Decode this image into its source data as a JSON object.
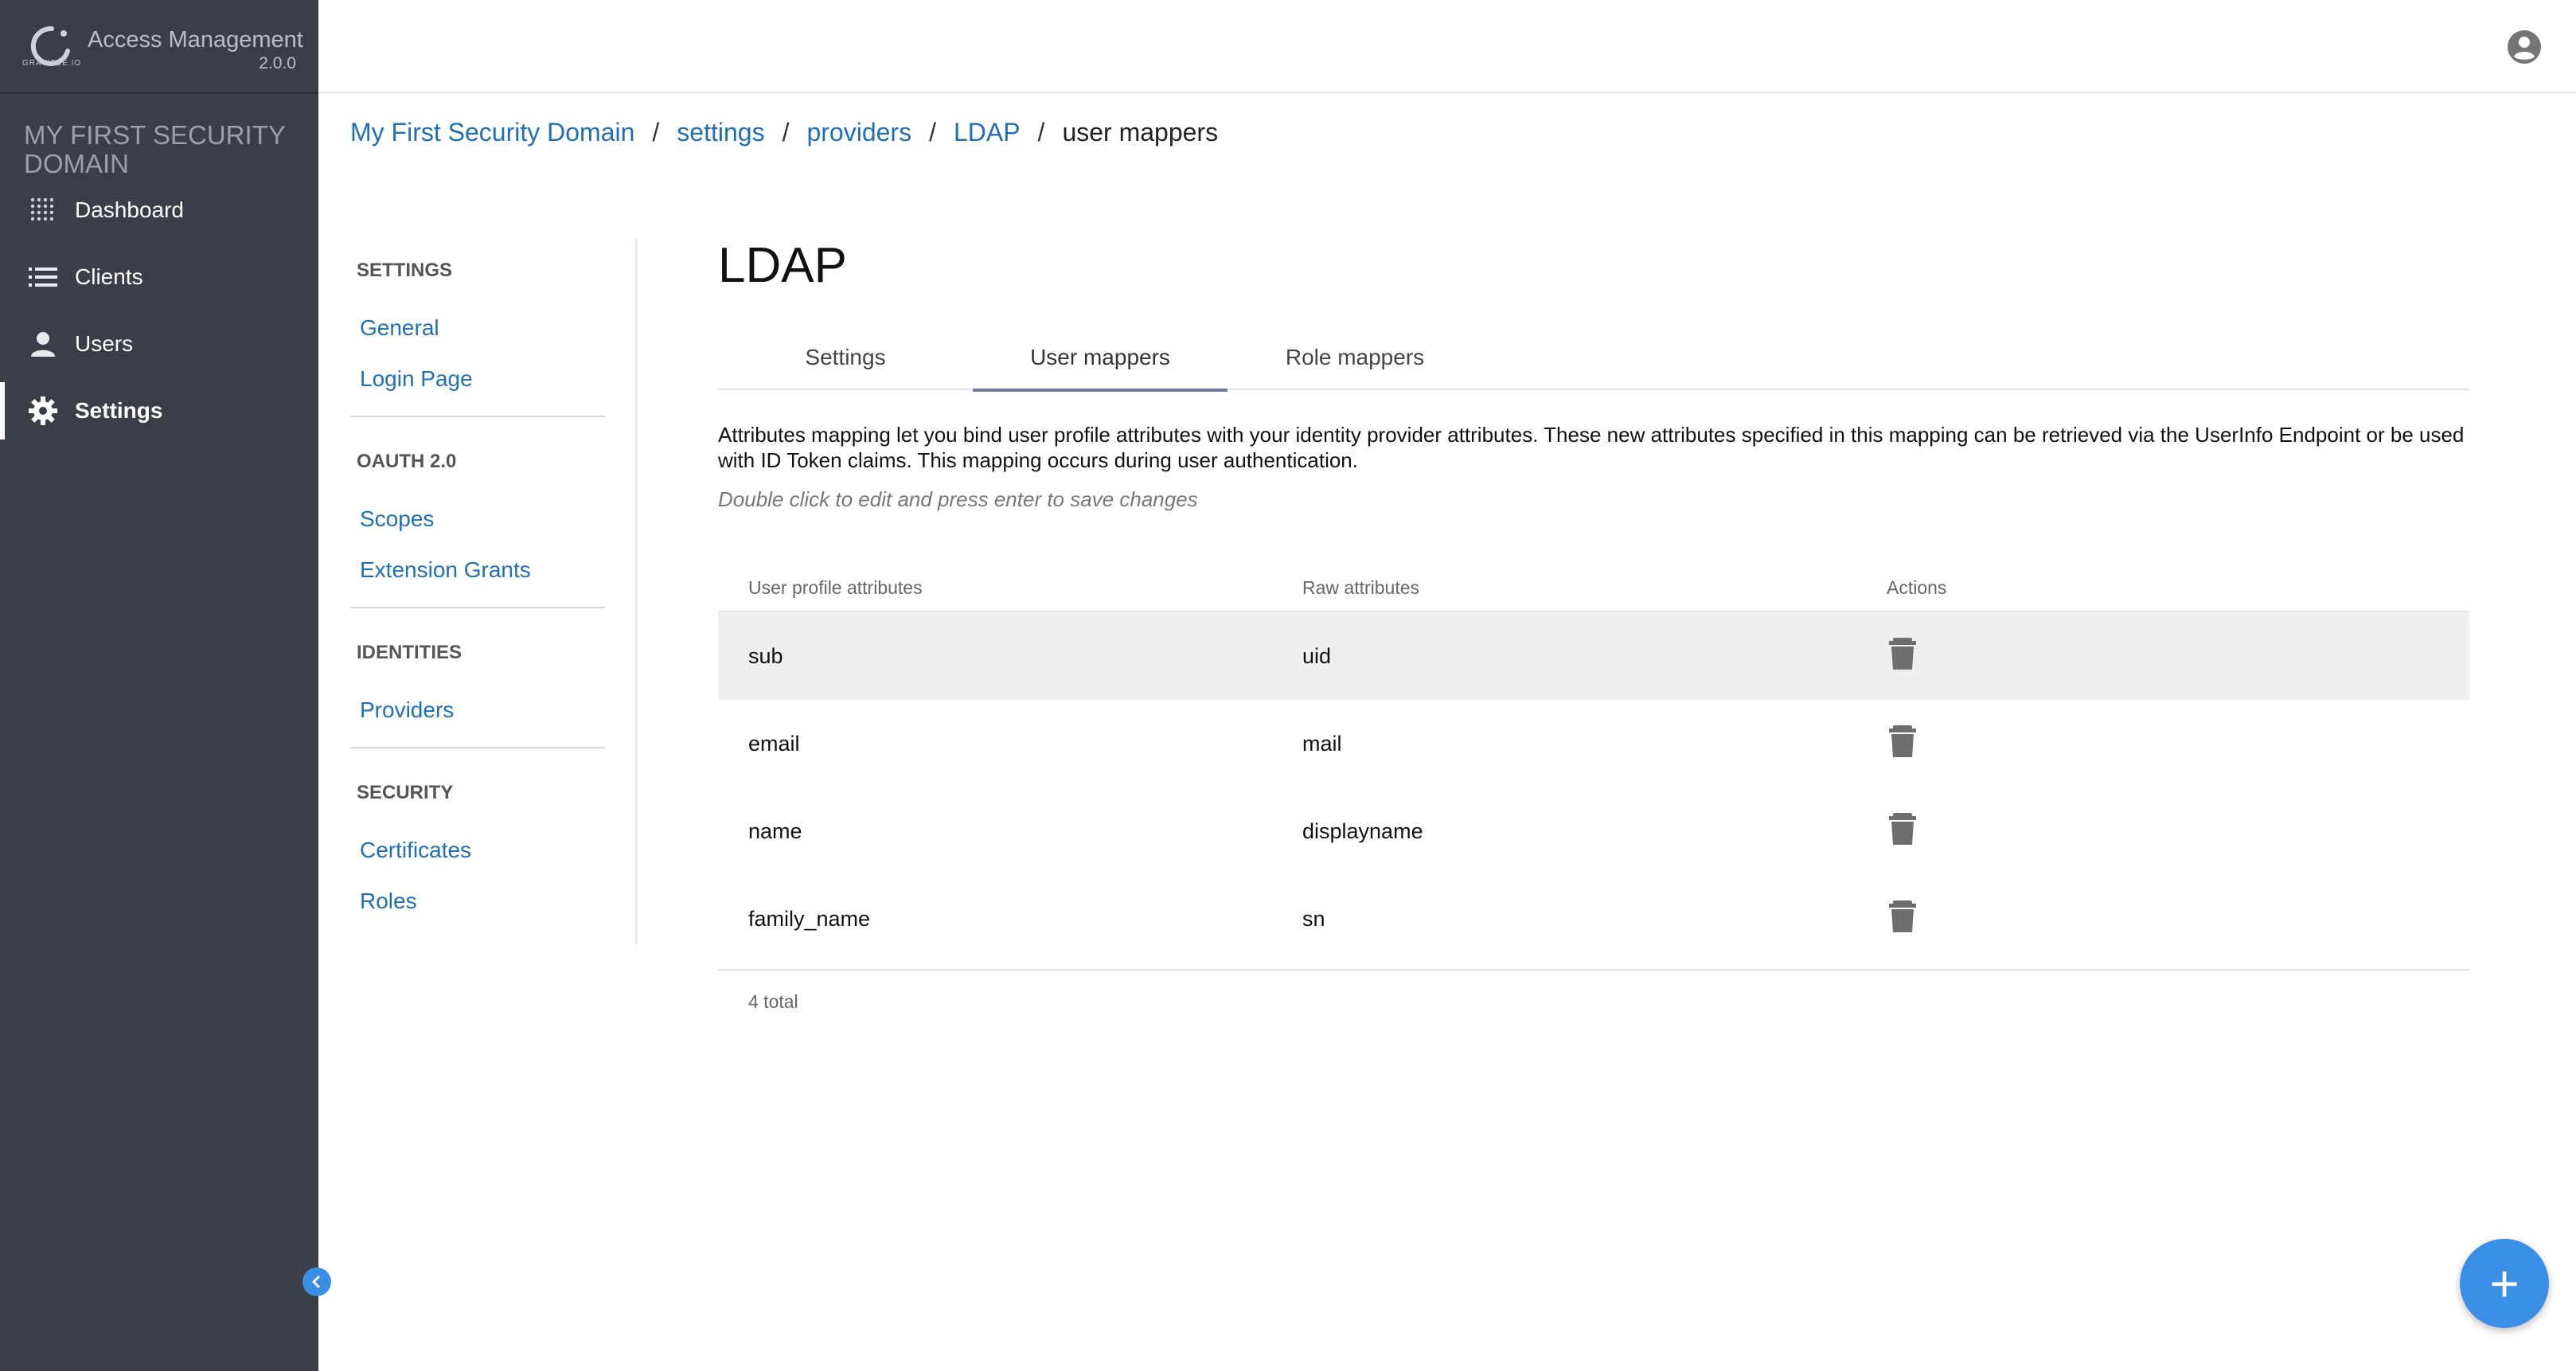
{
  "app": {
    "logo_text": "GRAVITEE.IO",
    "name": "Access Management",
    "version": "2.0.0"
  },
  "sidebar": {
    "domain_title": "MY FIRST SECURITY DOMAIN",
    "items": [
      {
        "label": "Dashboard",
        "icon": "dashboard-icon",
        "active": false
      },
      {
        "label": "Clients",
        "icon": "list-icon",
        "active": false
      },
      {
        "label": "Users",
        "icon": "person-icon",
        "active": false
      },
      {
        "label": "Settings",
        "icon": "gear-icon",
        "active": true
      }
    ]
  },
  "breadcrumb": {
    "items": [
      "My First Security Domain",
      "settings",
      "providers",
      "LDAP"
    ],
    "current": "user mappers",
    "separator": "/"
  },
  "submenu": {
    "sections": [
      {
        "title": "SETTINGS",
        "links": [
          "General",
          "Login Page"
        ]
      },
      {
        "title": "OAUTH 2.0",
        "links": [
          "Scopes",
          "Extension Grants"
        ]
      },
      {
        "title": "IDENTITIES",
        "links": [
          "Providers"
        ]
      },
      {
        "title": "SECURITY",
        "links": [
          "Certificates",
          "Roles"
        ]
      }
    ]
  },
  "main": {
    "title": "LDAP",
    "tabs": [
      {
        "label": "Settings",
        "active": false
      },
      {
        "label": "User mappers",
        "active": true
      },
      {
        "label": "Role mappers",
        "active": false
      }
    ],
    "description": "Attributes mapping let you bind user profile attributes with your identity provider attributes. These new attributes specified in this mapping can be retrieved via the UserInfo Endpoint or be used with ID Token claims. This mapping occurs during user authentication.",
    "hint": "Double click to edit and press enter to save changes",
    "table": {
      "headers": [
        "User profile attributes",
        "Raw attributes",
        "Actions"
      ],
      "rows": [
        {
          "profile": "sub",
          "raw": "uid"
        },
        {
          "profile": "email",
          "raw": "mail"
        },
        {
          "profile": "name",
          "raw": "displayname"
        },
        {
          "profile": "family_name",
          "raw": "sn"
        }
      ],
      "footer": "4 total"
    }
  },
  "fab": {
    "symbol": "+"
  },
  "colors": {
    "sidebar_bg": "#3a3e48",
    "link": "#1f6fb2",
    "accent": "#3a8ee6",
    "tab_indicator": "#6a7c91"
  }
}
